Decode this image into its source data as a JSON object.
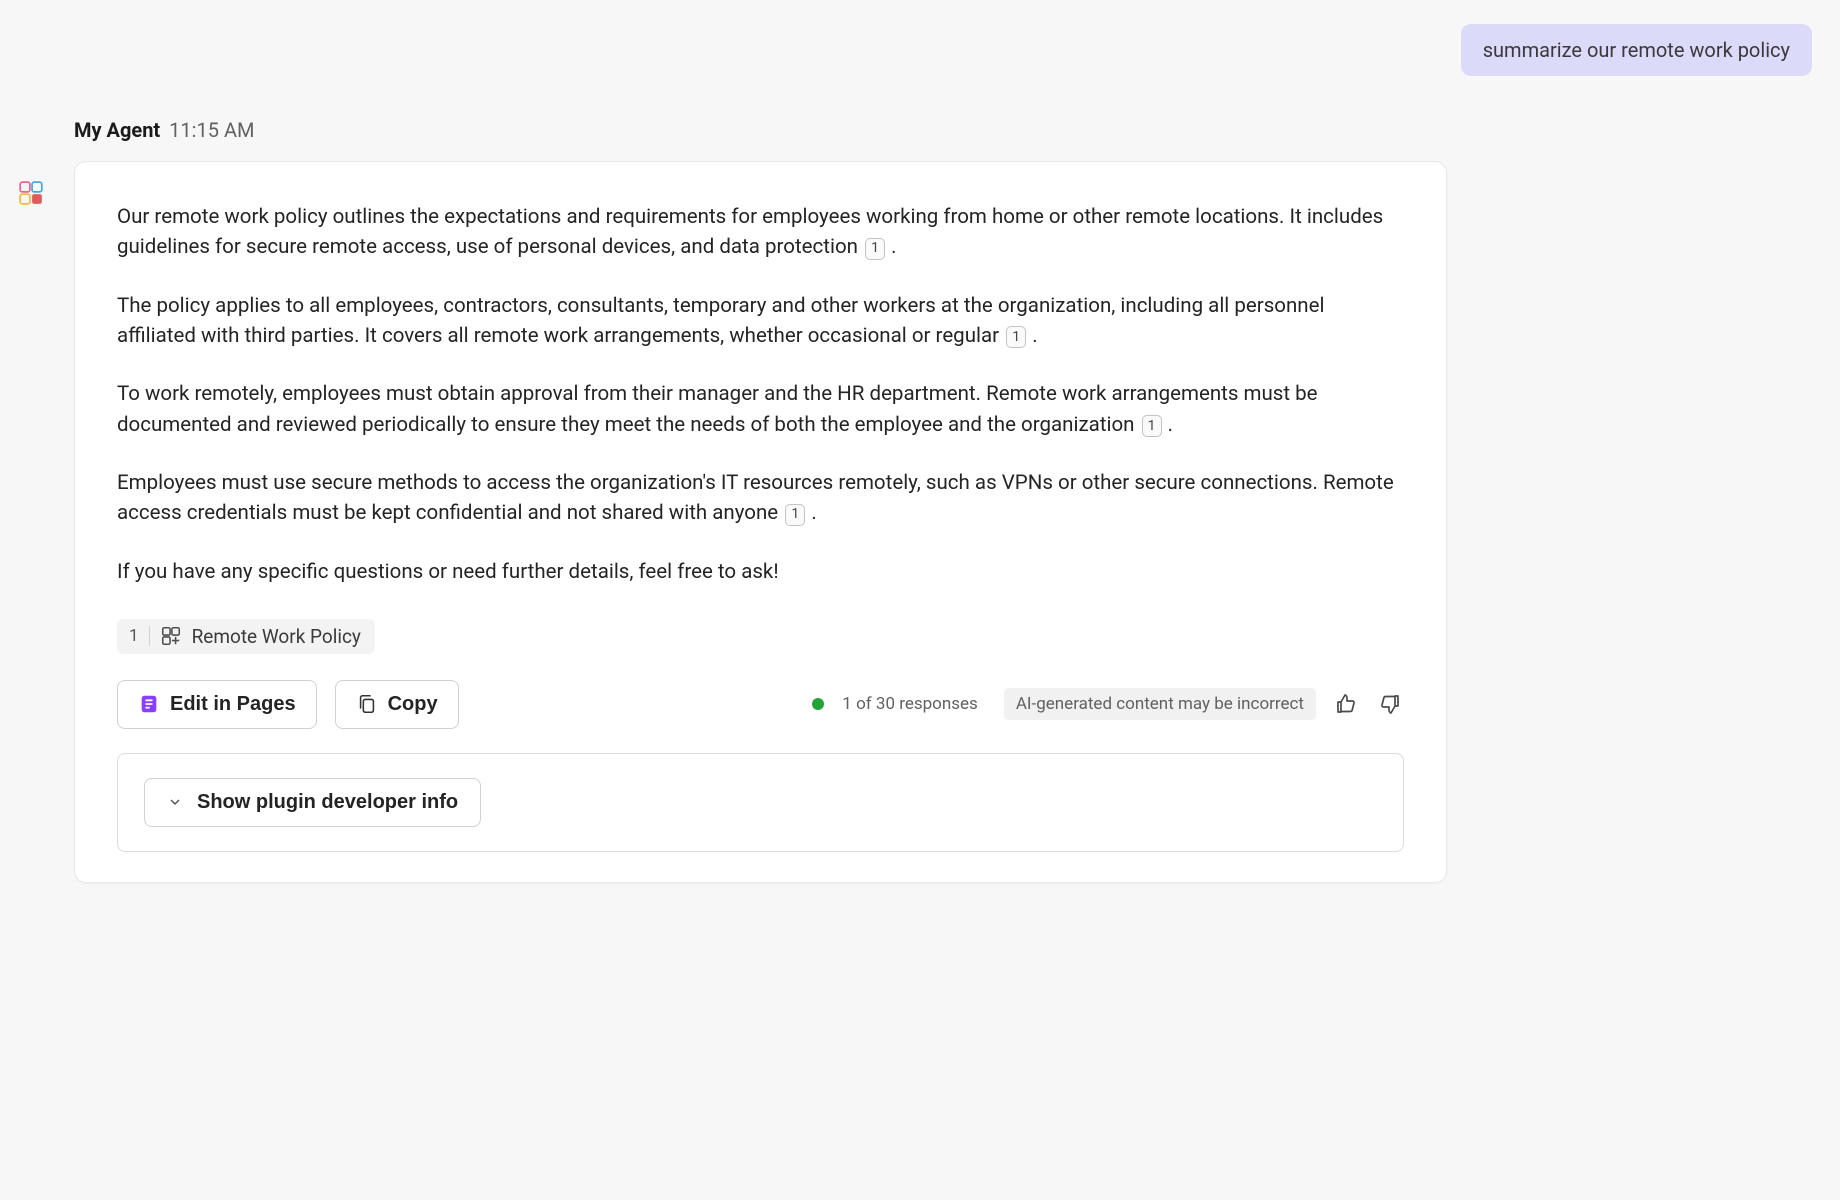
{
  "user_message": "summarize our remote work policy",
  "agent": {
    "name": "My Agent",
    "time": "11:15 AM"
  },
  "response": {
    "paragraphs": [
      {
        "text": "Our remote work policy outlines the expectations and requirements for employees working from home or other remote locations. It includes guidelines for secure remote access, use of personal devices, and data protection",
        "ref": "1"
      },
      {
        "text": "The policy applies to all employees, contractors, consultants, temporary and other workers at the organization, including all personnel affiliated with third parties. It covers all remote work arrangements, whether occasional or regular",
        "ref": "1"
      },
      {
        "text": "To work remotely, employees must obtain approval from their manager and the HR department. Remote work arrangements must be documented and reviewed periodically to ensure they meet the needs of both the employee and the organization",
        "ref": "1"
      },
      {
        "text": "Employees must use secure methods to access the organization's IT resources remotely, such as VPNs or other secure connections. Remote access credentials must be kept confidential and not shared with anyone",
        "ref": "1"
      },
      {
        "text": "If you have any specific questions or need further details, feel free to ask!",
        "ref": null
      }
    ],
    "source": {
      "index": "1",
      "title": "Remote Work Policy"
    }
  },
  "actions": {
    "edit_in_pages": "Edit in Pages",
    "copy": "Copy",
    "responses_counter": "1 of 30 responses",
    "disclaimer": "AI-generated content may be incorrect",
    "dev_toggle": "Show plugin developer info"
  }
}
